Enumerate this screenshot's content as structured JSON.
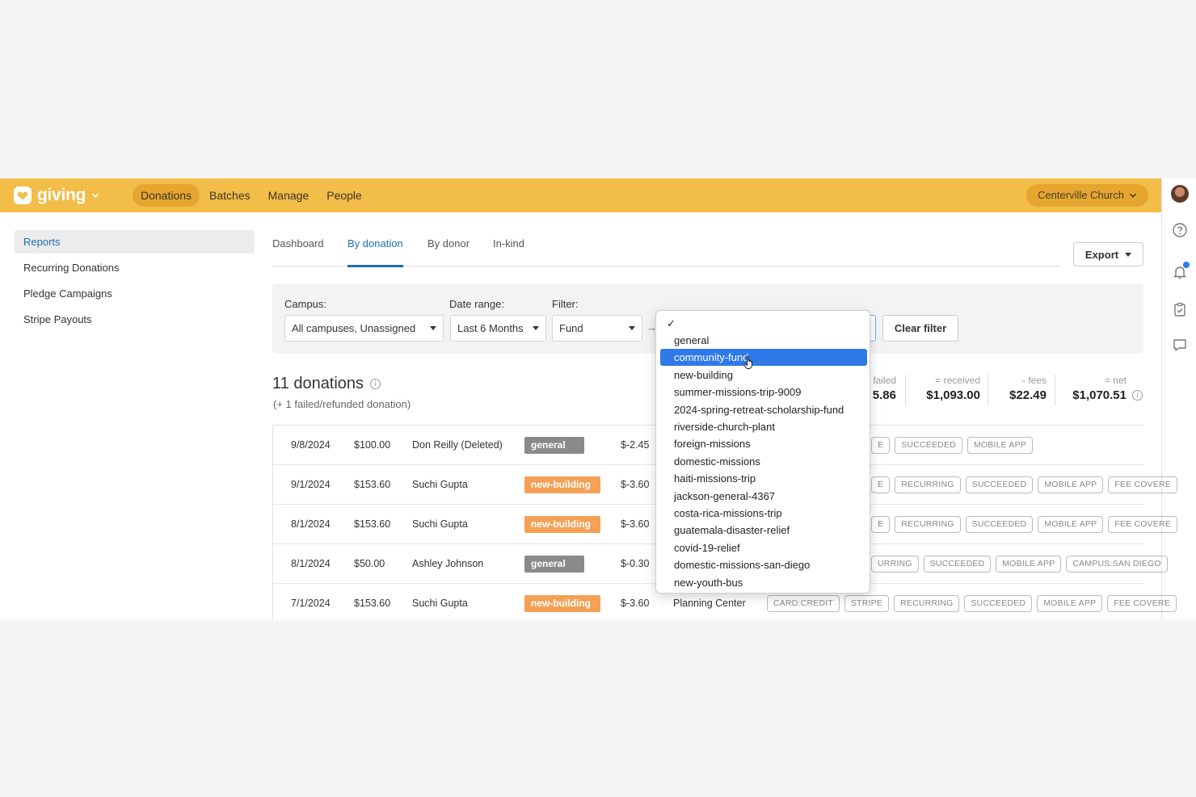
{
  "app": {
    "name": "giving",
    "brand_color": "#f2bd48",
    "accent_color": "#1a6fb5",
    "logo_icon": "heart-icon"
  },
  "nav": {
    "items": [
      {
        "label": "Donations",
        "active": true
      },
      {
        "label": "Batches",
        "active": false
      },
      {
        "label": "Manage",
        "active": false
      },
      {
        "label": "People",
        "active": false
      }
    ]
  },
  "org": {
    "label": "Centerville Church"
  },
  "rail": {
    "icons": [
      "avatar",
      "help-icon",
      "bell-icon",
      "clipboard-icon",
      "chat-icon"
    ]
  },
  "sidebar": {
    "items": [
      {
        "label": "Reports",
        "active": true
      },
      {
        "label": "Recurring Donations",
        "active": false
      },
      {
        "label": "Pledge Campaigns",
        "active": false
      },
      {
        "label": "Stripe Payouts",
        "active": false
      }
    ]
  },
  "tabs": [
    {
      "label": "Dashboard",
      "active": false
    },
    {
      "label": "By donation",
      "active": true
    },
    {
      "label": "By donor",
      "active": false
    },
    {
      "label": "In-kind",
      "active": false
    }
  ],
  "export": {
    "label": "Export"
  },
  "filters": {
    "campus": {
      "label": "Campus:",
      "value": "All campuses, Unassigned"
    },
    "date_range": {
      "label": "Date range:",
      "value": "Last 6 Months"
    },
    "filter": {
      "label": "Filter:",
      "value": "Fund"
    },
    "arrow": "→",
    "clear": "Clear filter"
  },
  "summary": {
    "title": "11 donations",
    "subtitle": "(+ 1 failed/refunded donation)",
    "failed_label": "failed",
    "failed_value": "5.86",
    "received_label": "= received",
    "received_value": "$1,093.00",
    "fees_label": "- fees",
    "fees_value": "$22.49",
    "net_label": "= net",
    "net_value": "$1,070.51"
  },
  "rows": [
    {
      "date": "9/8/2024",
      "amount": "$100.00",
      "donor": "Don Reilly (Deleted)",
      "fund": "general",
      "fee": "$-2.45",
      "source": "",
      "tags": [
        "E",
        "SUCCEEDED",
        "MOBILE APP"
      ]
    },
    {
      "date": "9/1/2024",
      "amount": "$153.60",
      "donor": "Suchi Gupta",
      "fund": "new-building",
      "fee": "$-3.60",
      "source": "",
      "tags": [
        "E",
        "RECURRING",
        "SUCCEEDED",
        "MOBILE APP",
        "FEE COVERE"
      ]
    },
    {
      "date": "8/1/2024",
      "amount": "$153.60",
      "donor": "Suchi Gupta",
      "fund": "new-building",
      "fee": "$-3.60",
      "source": "",
      "tags": [
        "E",
        "RECURRING",
        "SUCCEEDED",
        "MOBILE APP",
        "FEE COVERE"
      ]
    },
    {
      "date": "8/1/2024",
      "amount": "$50.00",
      "donor": "Ashley Johnson",
      "fund": "general",
      "fee": "$-0.30",
      "source": "",
      "tags": [
        "URRING",
        "SUCCEEDED",
        "MOBILE APP",
        "CAMPUS:SAN DIEGO"
      ]
    },
    {
      "date": "7/1/2024",
      "amount": "$153.60",
      "donor": "Suchi Gupta",
      "fund": "new-building",
      "fee": "$-3.60",
      "source": "Planning Center",
      "tags": [
        "CARD:CREDIT",
        "STRIPE",
        "RECURRING",
        "SUCCEEDED",
        "MOBILE APP",
        "FEE COVERE"
      ]
    }
  ],
  "dropdown": {
    "check": "✓",
    "selected_index": 1,
    "options": [
      "general",
      "community-fund",
      "new-building",
      "summer-missions-trip-9009",
      "2024-spring-retreat-scholarship-fund",
      "riverside-church-plant",
      "foreign-missions",
      "domestic-missions",
      "haiti-missions-trip",
      "jackson-general-4367",
      "costa-rica-missions-trip",
      "guatemala-disaster-relief",
      "covid-19-relief",
      "domestic-missions-san-diego",
      "new-youth-bus"
    ]
  }
}
